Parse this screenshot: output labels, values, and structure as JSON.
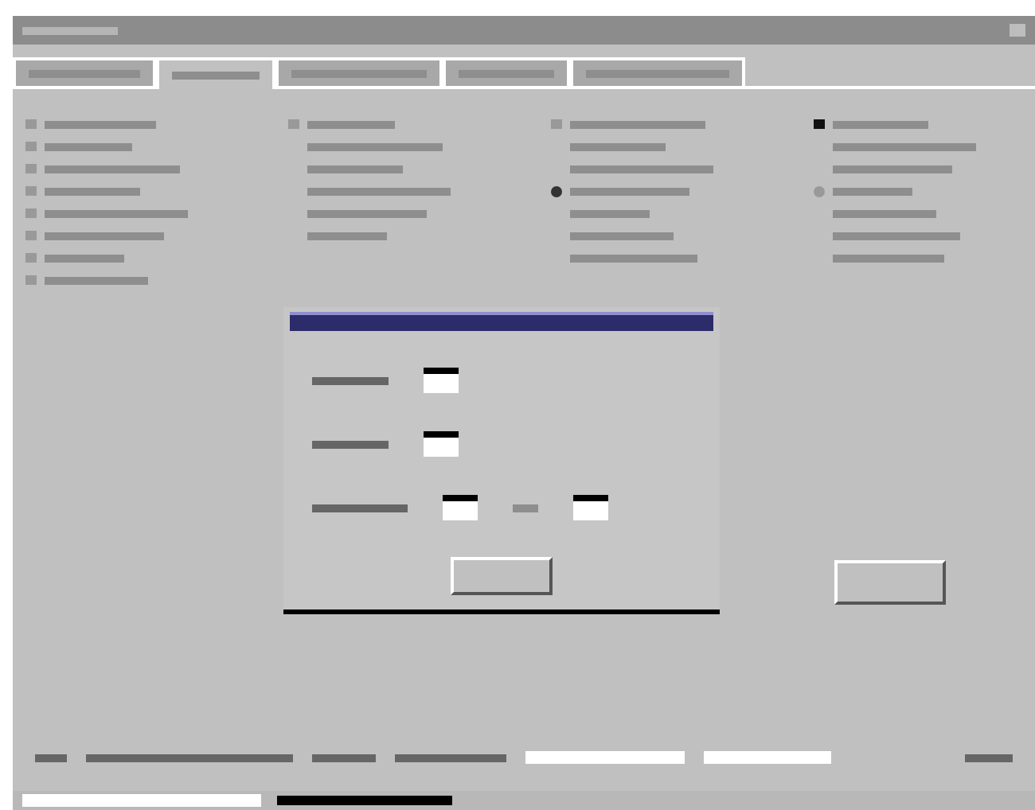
{
  "tabs": [
    {
      "selected": false
    },
    {
      "selected": true
    },
    {
      "selected": false
    },
    {
      "selected": false
    },
    {
      "selected": false
    }
  ],
  "option_columns": [
    {
      "items": [
        {
          "kind": "checkbox",
          "checked": false
        },
        {
          "kind": "checkbox",
          "checked": false
        },
        {
          "kind": "checkbox",
          "checked": false
        },
        {
          "kind": "checkbox",
          "checked": false
        },
        {
          "kind": "checkbox",
          "checked": false
        },
        {
          "kind": "checkbox",
          "checked": false
        },
        {
          "kind": "checkbox",
          "checked": false
        },
        {
          "kind": "checkbox",
          "checked": false
        }
      ]
    },
    {
      "items": [
        {
          "kind": "checkbox",
          "checked": false
        },
        {
          "kind": "text"
        },
        {
          "kind": "text"
        },
        {
          "kind": "text"
        },
        {
          "kind": "text"
        },
        {
          "kind": "text"
        }
      ]
    },
    {
      "items": [
        {
          "kind": "checkbox",
          "checked": false
        },
        {
          "kind": "text"
        },
        {
          "kind": "text"
        },
        {
          "kind": "radio",
          "checked": true
        },
        {
          "kind": "text"
        },
        {
          "kind": "text"
        },
        {
          "kind": "text"
        }
      ]
    },
    {
      "items": [
        {
          "kind": "checkbox",
          "checked": true
        },
        {
          "kind": "text"
        },
        {
          "kind": "text"
        },
        {
          "kind": "radio",
          "checked": false
        },
        {
          "kind": "text"
        },
        {
          "kind": "text"
        },
        {
          "kind": "text"
        }
      ]
    }
  ],
  "dialog": {
    "rows": [
      {
        "kind": "single"
      },
      {
        "kind": "single"
      },
      {
        "kind": "pair"
      }
    ]
  }
}
